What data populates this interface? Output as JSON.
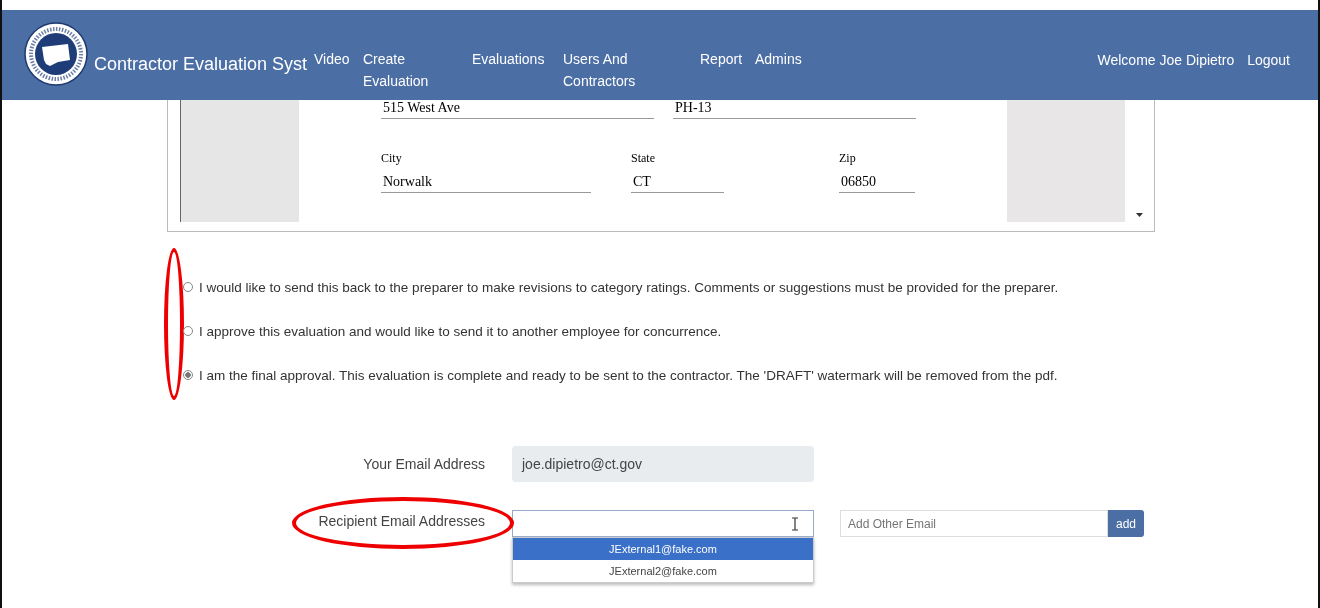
{
  "nav": {
    "title": "Contractor Evaluation Syst",
    "items": [
      {
        "label": "Video"
      },
      {
        "label": "Create Evaluation"
      },
      {
        "label": "Evaluations"
      },
      {
        "label": "Users And Contractors"
      },
      {
        "label": "Report"
      },
      {
        "label": "Admins"
      }
    ],
    "welcome": "Welcome Joe Dipietro",
    "logout": "Logout"
  },
  "document": {
    "address_fields": [
      {
        "value": "515 West Ave"
      },
      {
        "value": "PH-13"
      }
    ],
    "fields": [
      {
        "label": "City",
        "value": "Norwalk"
      },
      {
        "label": "State",
        "value": "CT"
      },
      {
        "label": "Zip",
        "value": "06850"
      }
    ]
  },
  "options": [
    {
      "text": "I would like to send this back to the preparer to make revisions to category ratings. Comments or suggestions must be provided for the preparer.",
      "selected": false
    },
    {
      "text": "I approve this evaluation and would like to send it to another employee for concurrence.",
      "selected": false
    },
    {
      "text": "I am the final approval. This evaluation is complete and ready to be sent to the contractor. The 'DRAFT' watermark will be removed from the pdf.",
      "selected": true
    }
  ],
  "your_email": {
    "label": "Your Email Address",
    "value": "joe.dipietro@ct.gov"
  },
  "recipients": {
    "label": "Recipient Email Addresses",
    "suggestions": [
      {
        "text": "JExternal1@fake.com",
        "selected": true
      },
      {
        "text": "JExternal2@fake.com",
        "selected": false
      }
    ],
    "other_placeholder": "Add Other Email",
    "add_button": "add"
  }
}
